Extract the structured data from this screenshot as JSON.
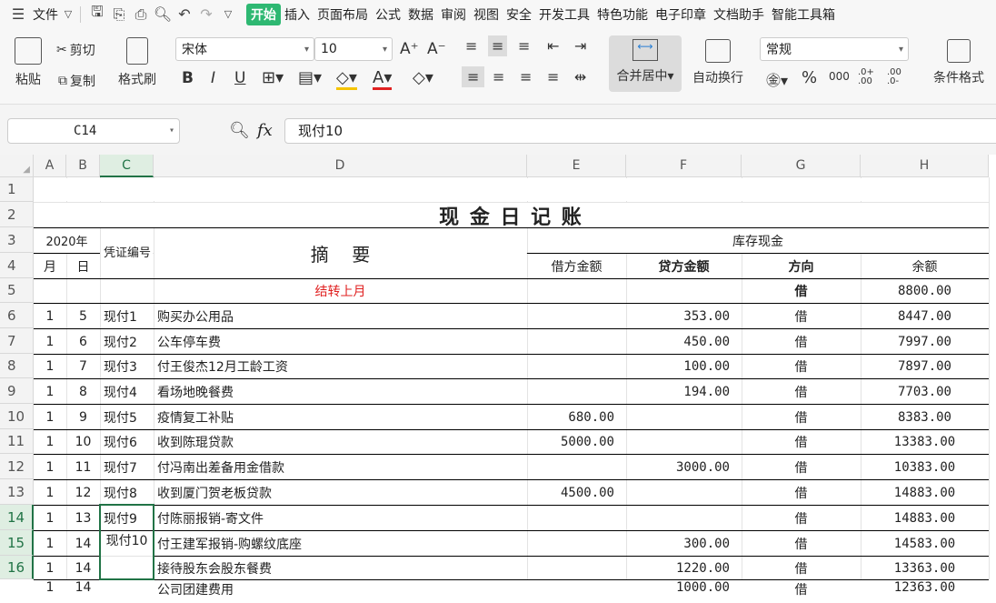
{
  "menubar": {
    "file": "文件",
    "tabs": [
      "开始",
      "插入",
      "页面布局",
      "公式",
      "数据",
      "审阅",
      "视图",
      "安全",
      "开发工具",
      "特色功能",
      "电子印章",
      "文档助手",
      "智能工具箱"
    ]
  },
  "ribbon": {
    "paste": "粘贴",
    "cut": "剪切",
    "copy": "复制",
    "format_painter": "格式刷",
    "font_name": "宋体",
    "font_size": "10",
    "bold": "B",
    "italic": "I",
    "underline": "U",
    "merge_center": "合并居中",
    "wrap_text": "自动换行",
    "number_format": "常规",
    "percent": "%",
    "thousands": "000",
    "inc_decimal": ".0+ .00",
    "dec_decimal": ".00 .0-",
    "conditional_format": "条件格式"
  },
  "formula": {
    "name_box": "C14",
    "fx": "fx",
    "content": "现付10"
  },
  "columns": [
    "A",
    "B",
    "C",
    "D",
    "E",
    "F",
    "G",
    "H"
  ],
  "rows": [
    "1",
    "2",
    "3",
    "4",
    "5",
    "6",
    "7",
    "8",
    "9",
    "10",
    "11",
    "12",
    "13",
    "14",
    "15",
    "16"
  ],
  "sheet": {
    "title": "现 金 日 记 账",
    "year_header": "2020年",
    "voucher_header": "凭证编号",
    "summary_header": "摘    要",
    "month_header": "月",
    "day_header": "日",
    "stock_header": "库存现金",
    "debit_header": "借方金额",
    "credit_header": "贷方金额",
    "direction_header": "方向",
    "balance_header": "余额",
    "carry_over": "结转上月",
    "carry_direction": "借",
    "carry_balance": "8800.00",
    "merged_voucher": "现付10",
    "entries": [
      {
        "m": "1",
        "d": "5",
        "v": "现付1",
        "s": "购买办公用品",
        "debit": "",
        "credit": "353.00",
        "dir": "借",
        "bal": "8447.00"
      },
      {
        "m": "1",
        "d": "6",
        "v": "现付2",
        "s": "公车停车费",
        "debit": "",
        "credit": "450.00",
        "dir": "借",
        "bal": "7997.00"
      },
      {
        "m": "1",
        "d": "7",
        "v": "现付3",
        "s": "付王俊杰12月工龄工资",
        "debit": "",
        "credit": "100.00",
        "dir": "借",
        "bal": "7897.00"
      },
      {
        "m": "1",
        "d": "8",
        "v": "现付4",
        "s": "看场地晚餐费",
        "debit": "",
        "credit": "194.00",
        "dir": "借",
        "bal": "7703.00"
      },
      {
        "m": "1",
        "d": "9",
        "v": "现付5",
        "s": "疫情复工补贴",
        "debit": "680.00",
        "credit": "",
        "dir": "借",
        "bal": "8383.00"
      },
      {
        "m": "1",
        "d": "10",
        "v": "现付6",
        "s": "收到陈琨贷款",
        "debit": "5000.00",
        "credit": "",
        "dir": "借",
        "bal": "13383.00"
      },
      {
        "m": "1",
        "d": "11",
        "v": "现付7",
        "s": "付冯南出差备用金借款",
        "debit": "",
        "credit": "3000.00",
        "dir": "借",
        "bal": "10383.00"
      },
      {
        "m": "1",
        "d": "12",
        "v": "现付8",
        "s": "收到厦门贺老板贷款",
        "debit": "4500.00",
        "credit": "",
        "dir": "借",
        "bal": "14883.00"
      },
      {
        "m": "1",
        "d": "13",
        "v": "现付9",
        "s": "付陈丽报销-寄文件",
        "debit": "",
        "credit": "",
        "dir": "借",
        "bal": "14883.00"
      },
      {
        "m": "1",
        "d": "14",
        "v": "",
        "s": "付王建军报销-购螺纹底座",
        "debit": "",
        "credit": "300.00",
        "dir": "借",
        "bal": "14583.00"
      },
      {
        "m": "1",
        "d": "14",
        "v": "",
        "s": "接待股东会股东餐费",
        "debit": "",
        "credit": "1220.00",
        "dir": "借",
        "bal": "13363.00"
      },
      {
        "m": "1",
        "d": "14",
        "v": "",
        "s": "公司团建费用",
        "debit": "",
        "credit": "1000.00",
        "dir": "借",
        "bal": "12363.00"
      }
    ]
  },
  "colors": {
    "accent": "#2eb872",
    "selection": "#217346",
    "carry_over": "#e02020"
  }
}
